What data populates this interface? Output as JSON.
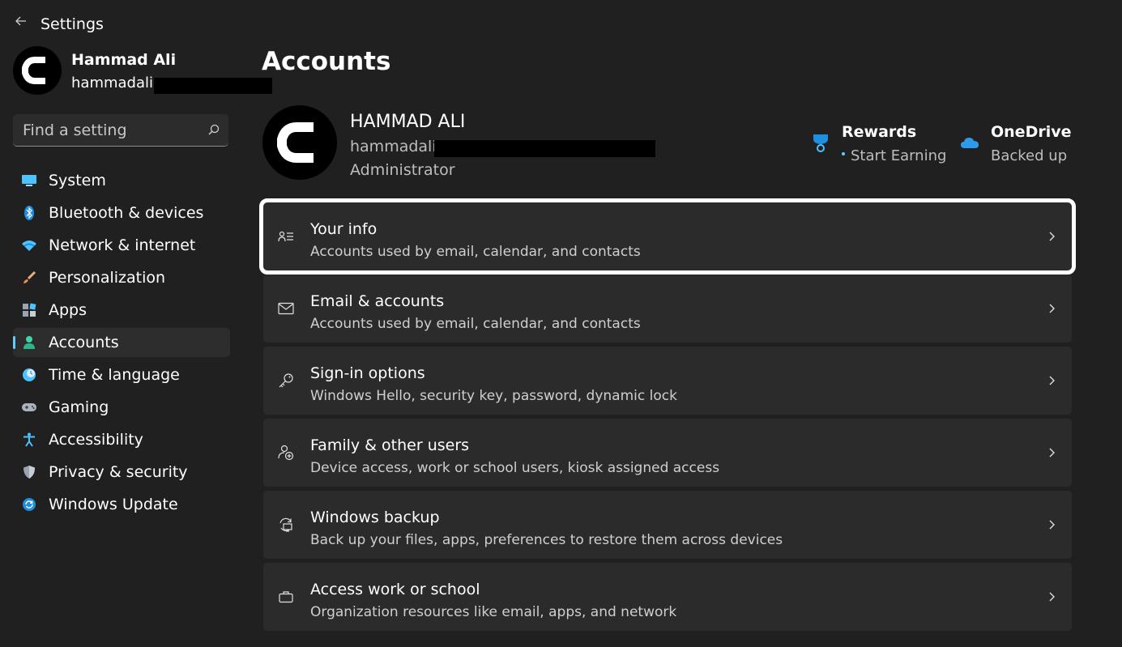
{
  "app": {
    "title": "Settings",
    "back_icon": "back-arrow-icon"
  },
  "profile": {
    "name": "Hammad Ali",
    "email_visible": "hammadali"
  },
  "search": {
    "placeholder": "Find a setting"
  },
  "nav": {
    "selected": "Accounts",
    "accent": "#60cdff",
    "items": [
      {
        "label": "System",
        "icon": "monitor-icon"
      },
      {
        "label": "Bluetooth & devices",
        "icon": "bluetooth-icon"
      },
      {
        "label": "Network & internet",
        "icon": "wifi-icon"
      },
      {
        "label": "Personalization",
        "icon": "brush-icon"
      },
      {
        "label": "Apps",
        "icon": "apps-icon"
      },
      {
        "label": "Accounts",
        "icon": "person-icon"
      },
      {
        "label": "Time & language",
        "icon": "globe-clock-icon"
      },
      {
        "label": "Gaming",
        "icon": "gamepad-icon"
      },
      {
        "label": "Accessibility",
        "icon": "accessibility-icon"
      },
      {
        "label": "Privacy & security",
        "icon": "shield-icon"
      },
      {
        "label": "Windows Update",
        "icon": "refresh-icon"
      }
    ]
  },
  "page": {
    "title": "Accounts"
  },
  "account": {
    "name": "HAMMAD ALI",
    "email_visible": "hammadali",
    "role": "Administrator"
  },
  "rewards": {
    "title": "Rewards",
    "subtitle": "Start Earning",
    "icon": "rewards-trophy-icon"
  },
  "onedrive": {
    "title": "OneDrive",
    "subtitle": "Backed up",
    "icon": "cloud-icon"
  },
  "cards": [
    {
      "title": "Your info",
      "desc": "Accounts used by email, calendar, and contacts",
      "icon": "contact-card-icon",
      "highlighted": true
    },
    {
      "title": "Email & accounts",
      "desc": "Accounts used by email, calendar, and contacts",
      "icon": "mail-icon"
    },
    {
      "title": "Sign-in options",
      "desc": "Windows Hello, security key, password, dynamic lock",
      "icon": "key-icon"
    },
    {
      "title": "Family & other users",
      "desc": "Device access, work or school users, kiosk assigned access",
      "icon": "add-person-icon"
    },
    {
      "title": "Windows backup",
      "desc": "Back up your files, apps, preferences to restore them across devices",
      "icon": "backup-icon"
    },
    {
      "title": "Access work or school",
      "desc": "Organization resources like email, apps, and network",
      "icon": "briefcase-icon"
    }
  ]
}
